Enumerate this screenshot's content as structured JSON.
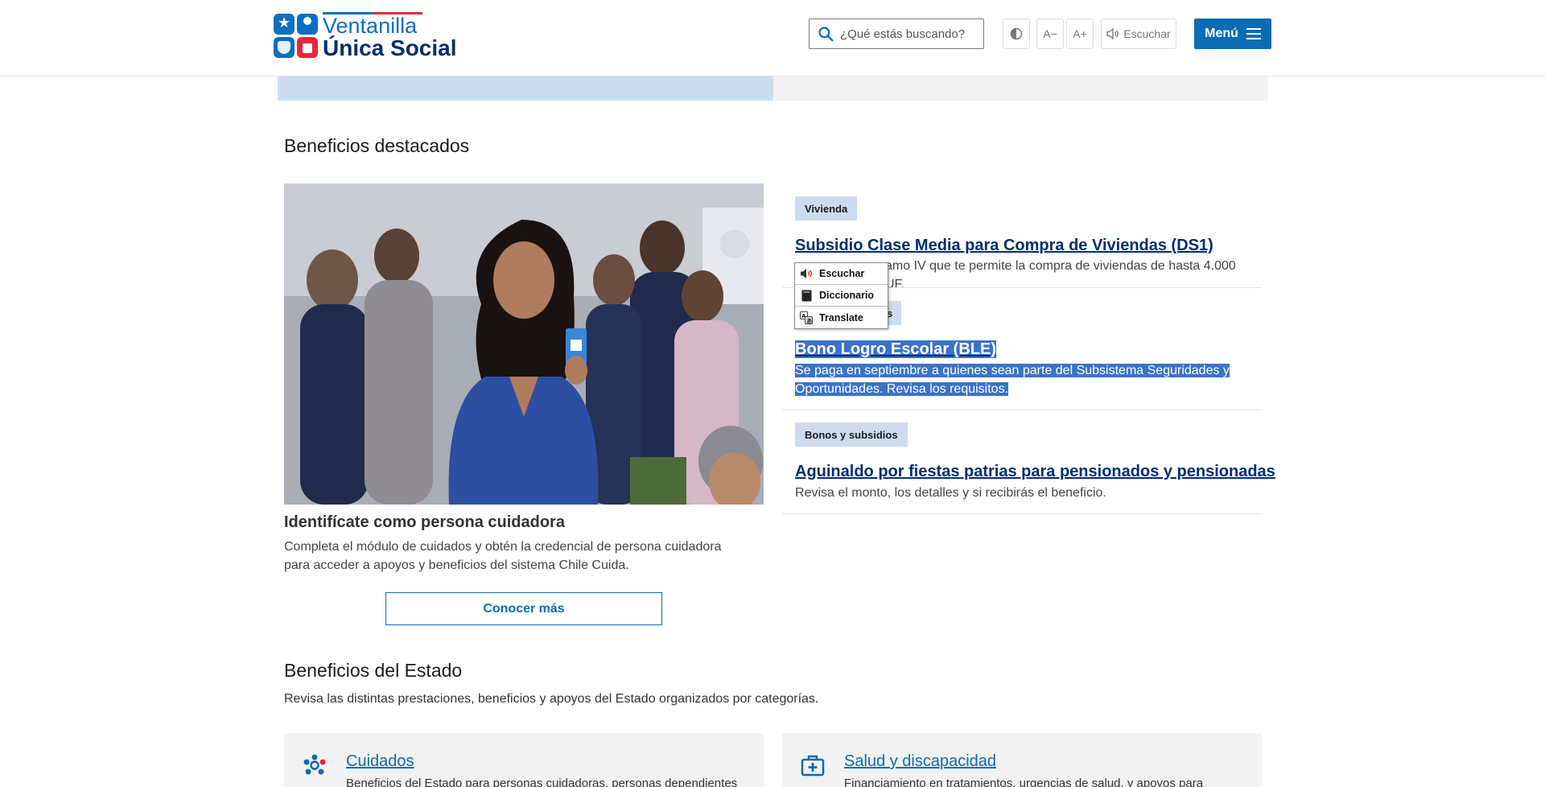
{
  "header": {
    "logo_line1": "Ventanilla",
    "logo_line2": "Única Social",
    "search_placeholder": "¿Qué estás buscando?",
    "font_decrease": "A−",
    "font_increase": "A+",
    "listen_label": "Escuchar",
    "menu_label": "Menú"
  },
  "featured": {
    "heading": "Beneficios destacados",
    "card": {
      "title": "Identifícate como persona cuidadora",
      "description": "Completa el módulo de cuidados y obtén la credencial de persona cuidadora para acceder a apoyos y beneficios del sistema Chile Cuida.",
      "button_label": "Conocer más"
    },
    "benefits": [
      {
        "tag": "Vivienda",
        "title": "Subsidio Clase Media para Compra de Viviendas (DS1)",
        "description": "Subsidio del Tramo IV que te permite la compra de viviendas de hasta 4.000 UF."
      },
      {
        "tag": "Bonos y subsidios",
        "title": "Bono Logro Escolar (BLE)",
        "description_line1": "Se paga en septiembre a quienes sean parte del Subsistema Seguridades y",
        "description_line2": "Oportunidades. Revisa los requisitos."
      },
      {
        "tag": "Bonos y subsidios",
        "title": "Aguinaldo por fiestas patrias para pensionados y pensionadas",
        "description": "Revisa el monto, los detalles y si recibirás el beneficio."
      }
    ],
    "benefit0_visible_desc": "amo IV que te permite la compra de viviendas de hasta 4.000 UF.",
    "benefit1_visible_tag": "s"
  },
  "context_menu": {
    "items": [
      "Escuchar",
      "Diccionario",
      "Translate"
    ]
  },
  "estado": {
    "heading": "Beneficios del Estado",
    "description": "Revisa las distintas prestaciones, beneficios y apoyos del Estado organizados por categorías.",
    "categories": [
      {
        "title": "Cuidados",
        "description": "Beneficios del Estado para personas cuidadoras, personas dependientes"
      },
      {
        "title": "Salud y discapacidad",
        "description": "Financiamiento en tratamientos, urgencias de salud, y apoyos para"
      }
    ]
  },
  "colors": {
    "primary": "#0a6cb4",
    "navy": "#002f6c",
    "accent_red": "#e5283a",
    "tag_bg": "#ccdcee",
    "selection": "#3a73c6"
  }
}
